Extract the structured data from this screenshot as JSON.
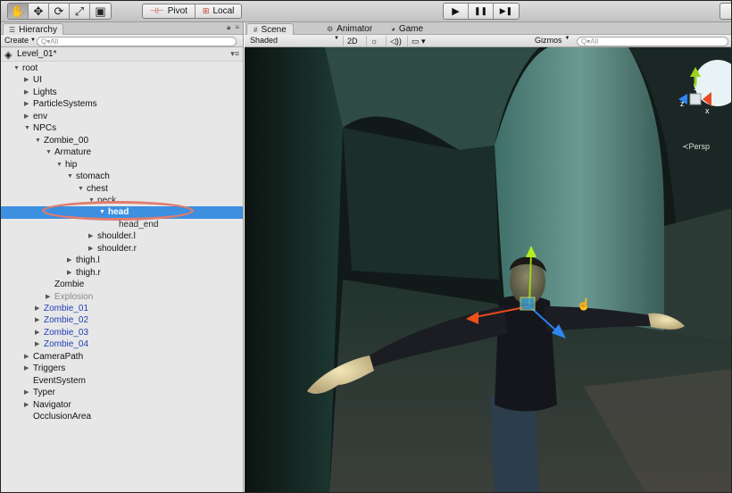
{
  "toolbar": {
    "tools": [
      {
        "name": "hand-tool",
        "glyph": "✋",
        "active": true
      },
      {
        "name": "move-tool",
        "glyph": "✥",
        "active": false
      },
      {
        "name": "rotate-tool",
        "glyph": "⟳",
        "active": false
      },
      {
        "name": "scale-tool",
        "glyph": "⤢",
        "active": false
      },
      {
        "name": "rect-tool",
        "glyph": "▣",
        "active": false
      }
    ],
    "pivot_label": "Pivot",
    "local_label": "Local",
    "play_glyph": "▶",
    "pause_glyph": "❚❚",
    "step_glyph": "▶❚"
  },
  "hierarchy": {
    "tab_label": "Hierarchy",
    "create_label": "Create",
    "search_placeholder": "Q▾All",
    "scene_name": "Level_01*",
    "selected_item": "head",
    "items": [
      {
        "label": "root",
        "depth": 0,
        "expanded": true,
        "has_children": true
      },
      {
        "label": "UI",
        "depth": 1,
        "has_children": true
      },
      {
        "label": "Lights",
        "depth": 1,
        "has_children": true
      },
      {
        "label": "ParticleSystems",
        "depth": 1,
        "has_children": true
      },
      {
        "label": "env",
        "depth": 1,
        "has_children": true
      },
      {
        "label": "NPCs",
        "depth": 1,
        "expanded": true,
        "has_children": true
      },
      {
        "label": "Zombie_00",
        "depth": 2,
        "expanded": true,
        "has_children": true
      },
      {
        "label": "Armature",
        "depth": 3,
        "expanded": true,
        "has_children": true
      },
      {
        "label": "hip",
        "depth": 4,
        "expanded": true,
        "has_children": true
      },
      {
        "label": "stomach",
        "depth": 5,
        "expanded": true,
        "has_children": true
      },
      {
        "label": "chest",
        "depth": 6,
        "expanded": true,
        "has_children": true
      },
      {
        "label": "neck",
        "depth": 7,
        "expanded": true,
        "has_children": true,
        "obscured": true
      },
      {
        "label": "head",
        "depth": 8,
        "expanded": true,
        "has_children": true,
        "selected": true
      },
      {
        "label": "head_end",
        "depth": 9,
        "has_children": false,
        "obscured": true
      },
      {
        "label": "shoulder.l",
        "depth": 7,
        "has_children": true
      },
      {
        "label": "shoulder.r",
        "depth": 7,
        "has_children": true
      },
      {
        "label": "thigh.l",
        "depth": 5,
        "has_children": true
      },
      {
        "label": "thigh.r",
        "depth": 5,
        "has_children": true
      },
      {
        "label": "Zombie",
        "depth": 3,
        "has_children": false
      },
      {
        "label": "Explosion",
        "depth": 3,
        "has_children": true,
        "style": "gray"
      },
      {
        "label": "Zombie_01",
        "depth": 2,
        "has_children": true,
        "style": "blue"
      },
      {
        "label": "Zombie_02",
        "depth": 2,
        "has_children": true,
        "style": "blue"
      },
      {
        "label": "Zombie_03",
        "depth": 2,
        "has_children": true,
        "style": "blue"
      },
      {
        "label": "Zombie_04",
        "depth": 2,
        "has_children": true,
        "style": "blue"
      },
      {
        "label": "CameraPath",
        "depth": 1,
        "has_children": true
      },
      {
        "label": "Triggers",
        "depth": 1,
        "has_children": true
      },
      {
        "label": "EventSystem",
        "depth": 1,
        "has_children": false
      },
      {
        "label": "Typer",
        "depth": 1,
        "has_children": true
      },
      {
        "label": "Navigator",
        "depth": 1,
        "has_children": true
      },
      {
        "label": "OcclusionArea",
        "depth": 1,
        "has_children": false
      }
    ]
  },
  "scene": {
    "tabs": [
      {
        "label": "Scene",
        "icon": "#",
        "active": true
      },
      {
        "label": "Animator",
        "icon": "⚙",
        "active": false
      },
      {
        "label": "Game",
        "icon": "◕",
        "active": false
      }
    ],
    "shading_mode": "Shaded",
    "mode_2d": "2D",
    "gizmos_label": "Gizmos",
    "search_placeholder": "Q▾All",
    "persp_label": "≺Persp",
    "axis_labels": {
      "y": "y",
      "z": "z",
      "x": "x"
    }
  },
  "colors": {
    "selection": "#3d8fe0",
    "highlight_ring": "#e07c6f",
    "prefab_blue": "#1f3fb5"
  }
}
